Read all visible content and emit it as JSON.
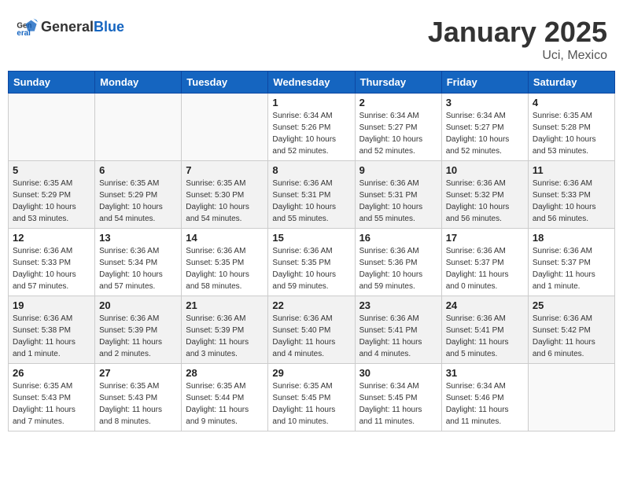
{
  "header": {
    "logo_general": "General",
    "logo_blue": "Blue",
    "month_year": "January 2025",
    "location": "Uci, Mexico"
  },
  "days_of_week": [
    "Sunday",
    "Monday",
    "Tuesday",
    "Wednesday",
    "Thursday",
    "Friday",
    "Saturday"
  ],
  "weeks": [
    [
      {
        "day": "",
        "info": ""
      },
      {
        "day": "",
        "info": ""
      },
      {
        "day": "",
        "info": ""
      },
      {
        "day": "1",
        "info": "Sunrise: 6:34 AM\nSunset: 5:26 PM\nDaylight: 10 hours\nand 52 minutes."
      },
      {
        "day": "2",
        "info": "Sunrise: 6:34 AM\nSunset: 5:27 PM\nDaylight: 10 hours\nand 52 minutes."
      },
      {
        "day": "3",
        "info": "Sunrise: 6:34 AM\nSunset: 5:27 PM\nDaylight: 10 hours\nand 52 minutes."
      },
      {
        "day": "4",
        "info": "Sunrise: 6:35 AM\nSunset: 5:28 PM\nDaylight: 10 hours\nand 53 minutes."
      }
    ],
    [
      {
        "day": "5",
        "info": "Sunrise: 6:35 AM\nSunset: 5:29 PM\nDaylight: 10 hours\nand 53 minutes."
      },
      {
        "day": "6",
        "info": "Sunrise: 6:35 AM\nSunset: 5:29 PM\nDaylight: 10 hours\nand 54 minutes."
      },
      {
        "day": "7",
        "info": "Sunrise: 6:35 AM\nSunset: 5:30 PM\nDaylight: 10 hours\nand 54 minutes."
      },
      {
        "day": "8",
        "info": "Sunrise: 6:36 AM\nSunset: 5:31 PM\nDaylight: 10 hours\nand 55 minutes."
      },
      {
        "day": "9",
        "info": "Sunrise: 6:36 AM\nSunset: 5:31 PM\nDaylight: 10 hours\nand 55 minutes."
      },
      {
        "day": "10",
        "info": "Sunrise: 6:36 AM\nSunset: 5:32 PM\nDaylight: 10 hours\nand 56 minutes."
      },
      {
        "day": "11",
        "info": "Sunrise: 6:36 AM\nSunset: 5:33 PM\nDaylight: 10 hours\nand 56 minutes."
      }
    ],
    [
      {
        "day": "12",
        "info": "Sunrise: 6:36 AM\nSunset: 5:33 PM\nDaylight: 10 hours\nand 57 minutes."
      },
      {
        "day": "13",
        "info": "Sunrise: 6:36 AM\nSunset: 5:34 PM\nDaylight: 10 hours\nand 57 minutes."
      },
      {
        "day": "14",
        "info": "Sunrise: 6:36 AM\nSunset: 5:35 PM\nDaylight: 10 hours\nand 58 minutes."
      },
      {
        "day": "15",
        "info": "Sunrise: 6:36 AM\nSunset: 5:35 PM\nDaylight: 10 hours\nand 59 minutes."
      },
      {
        "day": "16",
        "info": "Sunrise: 6:36 AM\nSunset: 5:36 PM\nDaylight: 10 hours\nand 59 minutes."
      },
      {
        "day": "17",
        "info": "Sunrise: 6:36 AM\nSunset: 5:37 PM\nDaylight: 11 hours\nand 0 minutes."
      },
      {
        "day": "18",
        "info": "Sunrise: 6:36 AM\nSunset: 5:37 PM\nDaylight: 11 hours\nand 1 minute."
      }
    ],
    [
      {
        "day": "19",
        "info": "Sunrise: 6:36 AM\nSunset: 5:38 PM\nDaylight: 11 hours\nand 1 minute."
      },
      {
        "day": "20",
        "info": "Sunrise: 6:36 AM\nSunset: 5:39 PM\nDaylight: 11 hours\nand 2 minutes."
      },
      {
        "day": "21",
        "info": "Sunrise: 6:36 AM\nSunset: 5:39 PM\nDaylight: 11 hours\nand 3 minutes."
      },
      {
        "day": "22",
        "info": "Sunrise: 6:36 AM\nSunset: 5:40 PM\nDaylight: 11 hours\nand 4 minutes."
      },
      {
        "day": "23",
        "info": "Sunrise: 6:36 AM\nSunset: 5:41 PM\nDaylight: 11 hours\nand 4 minutes."
      },
      {
        "day": "24",
        "info": "Sunrise: 6:36 AM\nSunset: 5:41 PM\nDaylight: 11 hours\nand 5 minutes."
      },
      {
        "day": "25",
        "info": "Sunrise: 6:36 AM\nSunset: 5:42 PM\nDaylight: 11 hours\nand 6 minutes."
      }
    ],
    [
      {
        "day": "26",
        "info": "Sunrise: 6:35 AM\nSunset: 5:43 PM\nDaylight: 11 hours\nand 7 minutes."
      },
      {
        "day": "27",
        "info": "Sunrise: 6:35 AM\nSunset: 5:43 PM\nDaylight: 11 hours\nand 8 minutes."
      },
      {
        "day": "28",
        "info": "Sunrise: 6:35 AM\nSunset: 5:44 PM\nDaylight: 11 hours\nand 9 minutes."
      },
      {
        "day": "29",
        "info": "Sunrise: 6:35 AM\nSunset: 5:45 PM\nDaylight: 11 hours\nand 10 minutes."
      },
      {
        "day": "30",
        "info": "Sunrise: 6:34 AM\nSunset: 5:45 PM\nDaylight: 11 hours\nand 11 minutes."
      },
      {
        "day": "31",
        "info": "Sunrise: 6:34 AM\nSunset: 5:46 PM\nDaylight: 11 hours\nand 11 minutes."
      },
      {
        "day": "",
        "info": ""
      }
    ]
  ]
}
